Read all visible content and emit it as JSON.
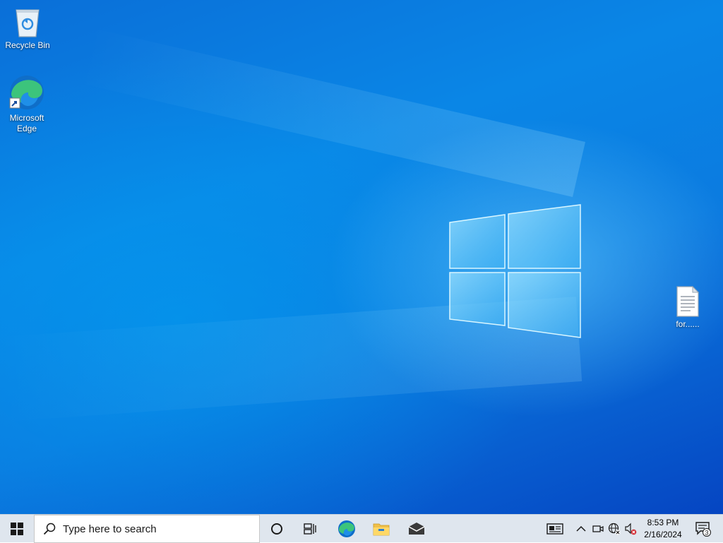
{
  "desktop": {
    "icons": [
      {
        "label": "Recycle Bin"
      },
      {
        "label": "Microsoft Edge"
      },
      {
        "label": "for......"
      }
    ]
  },
  "taskbar": {
    "search_placeholder": "Type here to search",
    "clock": {
      "time": "8:53 PM",
      "date": "2/16/2024"
    },
    "notification_count": "3"
  },
  "colors": {
    "desktop_blue": "#0a86e6",
    "taskbar_bg": "#dfe6ee",
    "edge_blue": "#0f6ec8",
    "edge_green": "#3cc47c",
    "folder_yellow": "#f0c04a"
  }
}
